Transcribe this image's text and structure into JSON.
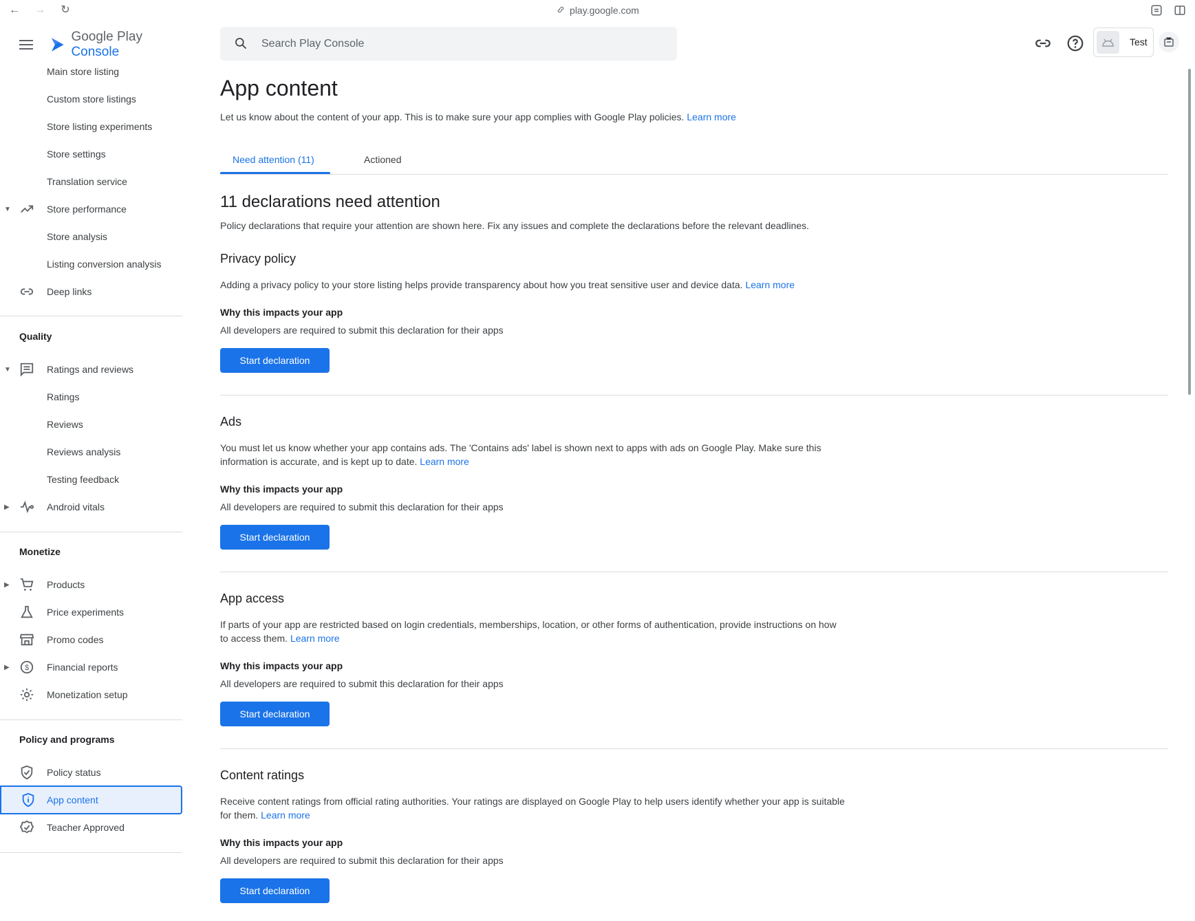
{
  "browser": {
    "url": "play.google.com"
  },
  "brand": {
    "name": "Google Play",
    "product": "Console"
  },
  "search": {
    "placeholder": "Search Play Console"
  },
  "account": {
    "label": "Test"
  },
  "sidebar": {
    "store_items": [
      "Main store listing",
      "Custom store listings",
      "Store listing experiments",
      "Store settings",
      "Translation service"
    ],
    "store_performance": "Store performance",
    "store_perf_items": [
      "Store analysis",
      "Listing conversion analysis"
    ],
    "deep_links": "Deep links",
    "quality_heading": "Quality",
    "ratings_reviews": "Ratings and reviews",
    "ratings_items": [
      "Ratings",
      "Reviews",
      "Reviews analysis",
      "Testing feedback"
    ],
    "android_vitals": "Android vitals",
    "monetize_heading": "Monetize",
    "products": "Products",
    "price_experiments": "Price experiments",
    "promo_codes": "Promo codes",
    "financial_reports": "Financial reports",
    "monetization_setup": "Monetization setup",
    "policy_heading": "Policy and programs",
    "policy_status": "Policy status",
    "app_content": "App content",
    "teacher_approved": "Teacher Approved"
  },
  "page": {
    "title": "App content",
    "description": "Let us know about the content of your app. This is to make sure your app complies with Google Play policies.",
    "learn_more": "Learn more",
    "tabs": [
      "Need attention (11)",
      "Actioned"
    ],
    "heading": "11 declarations need attention",
    "subheading": "Policy declarations that require your attention are shown here. Fix any issues and complete the declarations before the relevant deadlines.",
    "why_label": "Why this impacts your app",
    "why_text": "All developers are required to submit this declaration for their apps",
    "button_label": "Start declaration",
    "declarations": [
      {
        "title": "Privacy policy",
        "desc": "Adding a privacy policy to your store listing helps provide transparency about how you treat sensitive user and device data."
      },
      {
        "title": "Ads",
        "desc": "You must let us know whether your app contains ads. The 'Contains ads' label is shown next to apps with ads on Google Play. Make sure this information is accurate, and is kept up to date."
      },
      {
        "title": "App access",
        "desc": "If parts of your app are restricted based on login credentials, memberships, location, or other forms of authentication, provide instructions on how to access them."
      },
      {
        "title": "Content ratings",
        "desc": "Receive content ratings from official rating authorities. Your ratings are displayed on Google Play to help users identify whether your app is suitable for them."
      }
    ]
  },
  "colors": {
    "accent": "#1a73e8",
    "text": "#202124",
    "muted": "#5f6368"
  }
}
